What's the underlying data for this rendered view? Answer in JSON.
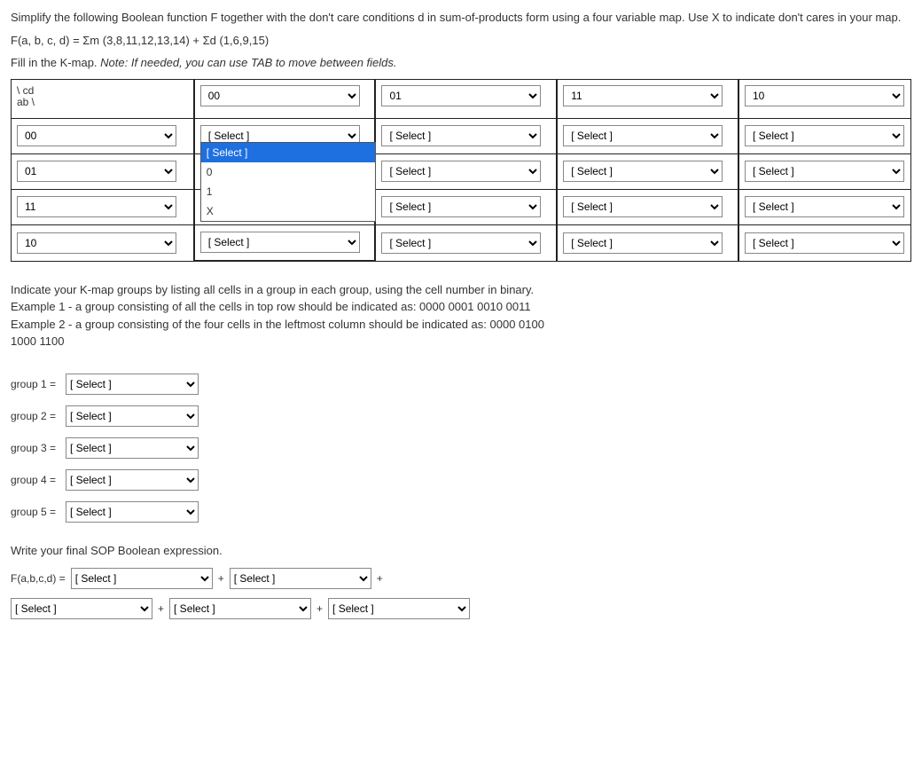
{
  "question": {
    "line1": "Simplify the following Boolean function F together with the don't care conditions d in sum-of-products form using a four variable map.  Use X to indicate don't cares in your map.",
    "eq": "F(a, b, c, d) = Σm (3,8,11,12,13,14) + Σd (1,6,9,15)",
    "line3a": "Fill in the K-map.  ",
    "line3b": "Note: If needed, you can use TAB to move between fields."
  },
  "kmap": {
    "corner_top": "\\ cd",
    "corner_bot": "ab \\",
    "col_headers": [
      "00",
      "01",
      "11",
      "10"
    ],
    "row_headers": [
      "00",
      "01",
      "11",
      "10"
    ],
    "cell_placeholder": "[ Select ]",
    "dropdown_options": [
      "[ Select ]",
      "0",
      "1",
      "X"
    ]
  },
  "groups_section": {
    "intro1": "Indicate your K-map groups by listing all cells in a group in each group, using the cell number in binary.",
    "ex1": "Example 1 - a group consisting of all the cells in top row should be indicated as: 0000 0001 0010 0011",
    "ex2": "Example 2 - a group consisting of the four cells in the leftmost column should be indicated as: 0000 0100 1000 1100",
    "labels": [
      "group 1 =",
      "group 2 =",
      "group 3 =",
      "group 4 =",
      "group 5 ="
    ],
    "placeholder": "[ Select ]"
  },
  "sop": {
    "title": "Write your final SOP Boolean expression.",
    "flabel": "F(a,b,c,d) =",
    "placeholder": "[ Select ]",
    "plus": "+"
  }
}
